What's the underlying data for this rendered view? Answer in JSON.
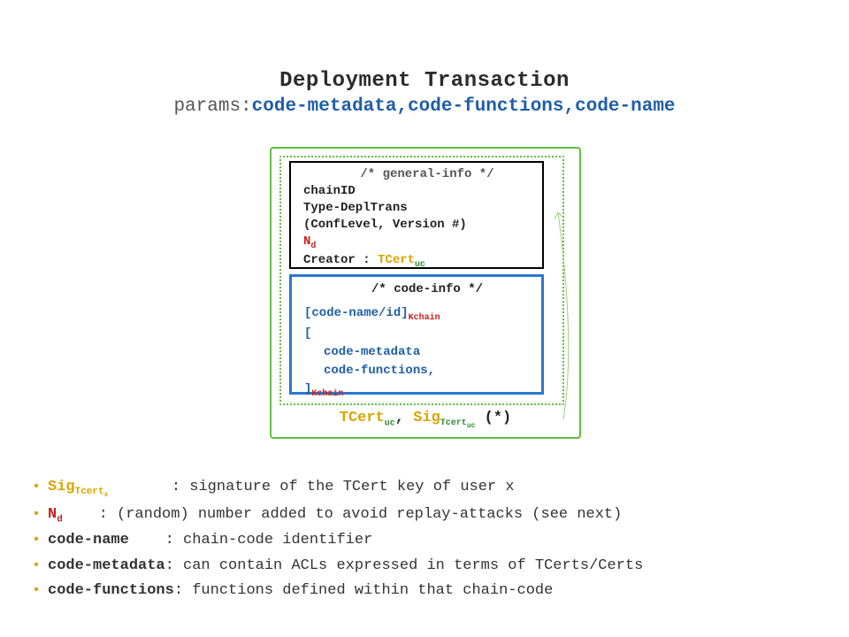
{
  "title": "Deployment Transaction",
  "subtitle": {
    "label": "params:",
    "value": "code-metadata,code-functions,code-name"
  },
  "general_info": {
    "comment": "/* general-info */",
    "lines": {
      "chain_id": "chainID",
      "type": "Type-DeplTrans",
      "conf": "(ConfLevel, Version #)",
      "nd": "N",
      "nd_sub": "d",
      "creator_label": "Creator : ",
      "creator_tcert": "TCert",
      "creator_tcert_sub": "uc"
    }
  },
  "code_info": {
    "comment": "/* code-info */",
    "line1_open": "[code-name/id]",
    "line1_sub": "Kchain",
    "line2": "[",
    "line3": "code-metadata",
    "line4": "code-functions,",
    "line5": "]",
    "line5_sub": "Kchain"
  },
  "sig_line": {
    "tcert": "TCert",
    "tcert_sub": "uc",
    "sep": ", ",
    "sig": "Sig",
    "sig_sub": "Tcert",
    "sig_subsub": "uc",
    "tail": " (*)"
  },
  "bullets": [
    {
      "term": "Sig",
      "term_sub": "Tcert",
      "term_subsub": "x",
      "term_class": "b-sig",
      "pad": "       ",
      "desc": ": signature of the TCert key of user x"
    },
    {
      "term": "N",
      "term_sub": "d",
      "term_subsub": "",
      "term_class": "b-nd",
      "pad": "    ",
      "desc": ": (random) number added to avoid replay-attacks (see next)"
    },
    {
      "term": "code-name",
      "term_sub": "",
      "term_subsub": "",
      "term_class": "",
      "pad": "    ",
      "desc": ": chain-code identifier"
    },
    {
      "term": "code-metadata",
      "term_sub": "",
      "term_subsub": "",
      "term_class": "",
      "pad": "",
      "desc": ": can contain ACLs expressed in terms of TCerts/Certs"
    },
    {
      "term": "code-functions",
      "term_sub": "",
      "term_subsub": "",
      "term_class": "",
      "pad": "",
      "desc": ": functions defined within that chain-code"
    }
  ]
}
